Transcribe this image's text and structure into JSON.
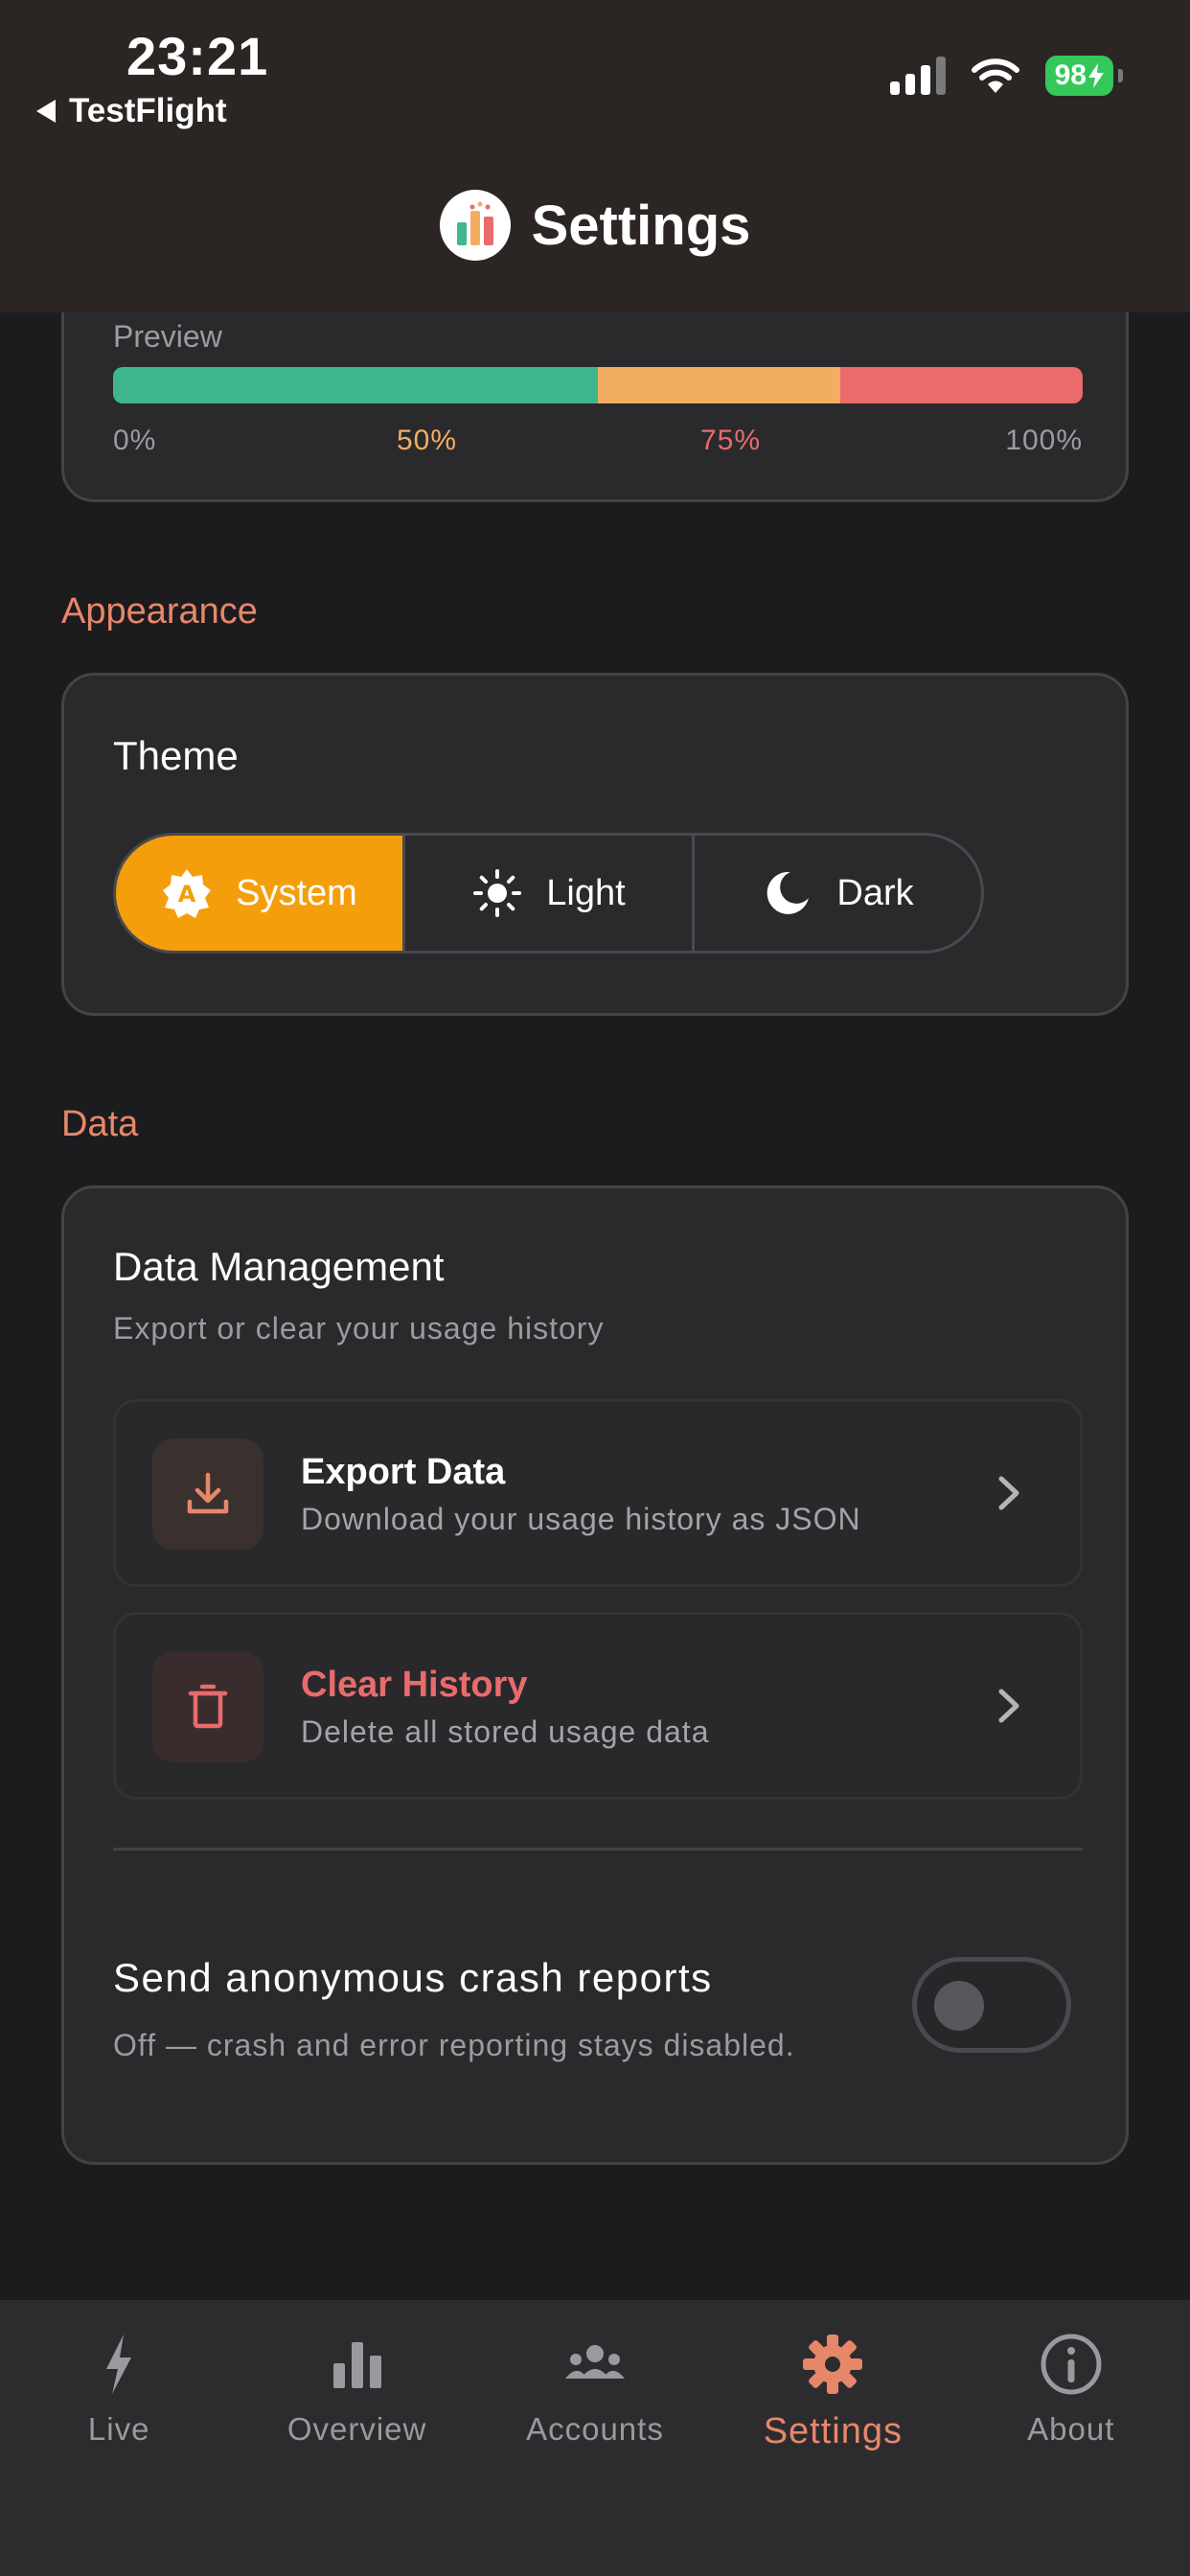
{
  "status_bar": {
    "time": "23:21",
    "back_label": "TestFlight",
    "battery": "98",
    "icons": [
      "signal-icon",
      "wifi-icon",
      "battery-charging-icon"
    ]
  },
  "header": {
    "title": "Settings",
    "logo": "app-logo-bar-chart-icon"
  },
  "preview": {
    "label": "Preview",
    "segments": [
      {
        "color": "#3fb68e",
        "fraction": 0.5
      },
      {
        "color": "#f3ad61",
        "fraction": 0.25
      },
      {
        "color": "#e96b6b",
        "fraction": 0.25
      }
    ],
    "ticks": [
      {
        "label": "0%",
        "color": "#9c9ca0"
      },
      {
        "label": "50%",
        "color": "#f3ad61"
      },
      {
        "label": "75%",
        "color": "#e96b6b"
      },
      {
        "label": "100%",
        "color": "#9c9ca0"
      }
    ]
  },
  "appearance": {
    "section_label": "Appearance",
    "theme_title": "Theme",
    "options": [
      {
        "label": "System",
        "icon": "auto-theme-icon",
        "selected": true
      },
      {
        "label": "Light",
        "icon": "sun-icon",
        "selected": false
      },
      {
        "label": "Dark",
        "icon": "moon-icon",
        "selected": false
      }
    ],
    "accent_color": "#f59e0b"
  },
  "data": {
    "section_label": "Data",
    "title": "Data Management",
    "subtitle": "Export or clear your usage history",
    "export": {
      "title": "Export Data",
      "subtitle": "Download your usage history as JSON",
      "icon": "download-icon"
    },
    "clear": {
      "title": "Clear History",
      "subtitle": "Delete all stored usage data",
      "icon": "trash-icon",
      "color": "#e96b6b"
    },
    "crash": {
      "title": "Send anonymous crash reports",
      "subtitle": "Off — crash and error reporting stays disabled.",
      "enabled": false
    }
  },
  "tabs": [
    {
      "label": "Live",
      "icon": "bolt-icon",
      "active": false
    },
    {
      "label": "Overview",
      "icon": "bar-chart-icon",
      "active": false
    },
    {
      "label": "Accounts",
      "icon": "users-icon",
      "active": false
    },
    {
      "label": "Settings",
      "icon": "gear-icon",
      "active": true
    },
    {
      "label": "About",
      "icon": "info-icon",
      "active": false
    }
  ],
  "colors": {
    "accent": "#e7876a",
    "background": "#1c1c1e",
    "card": "#2a2a2d"
  }
}
